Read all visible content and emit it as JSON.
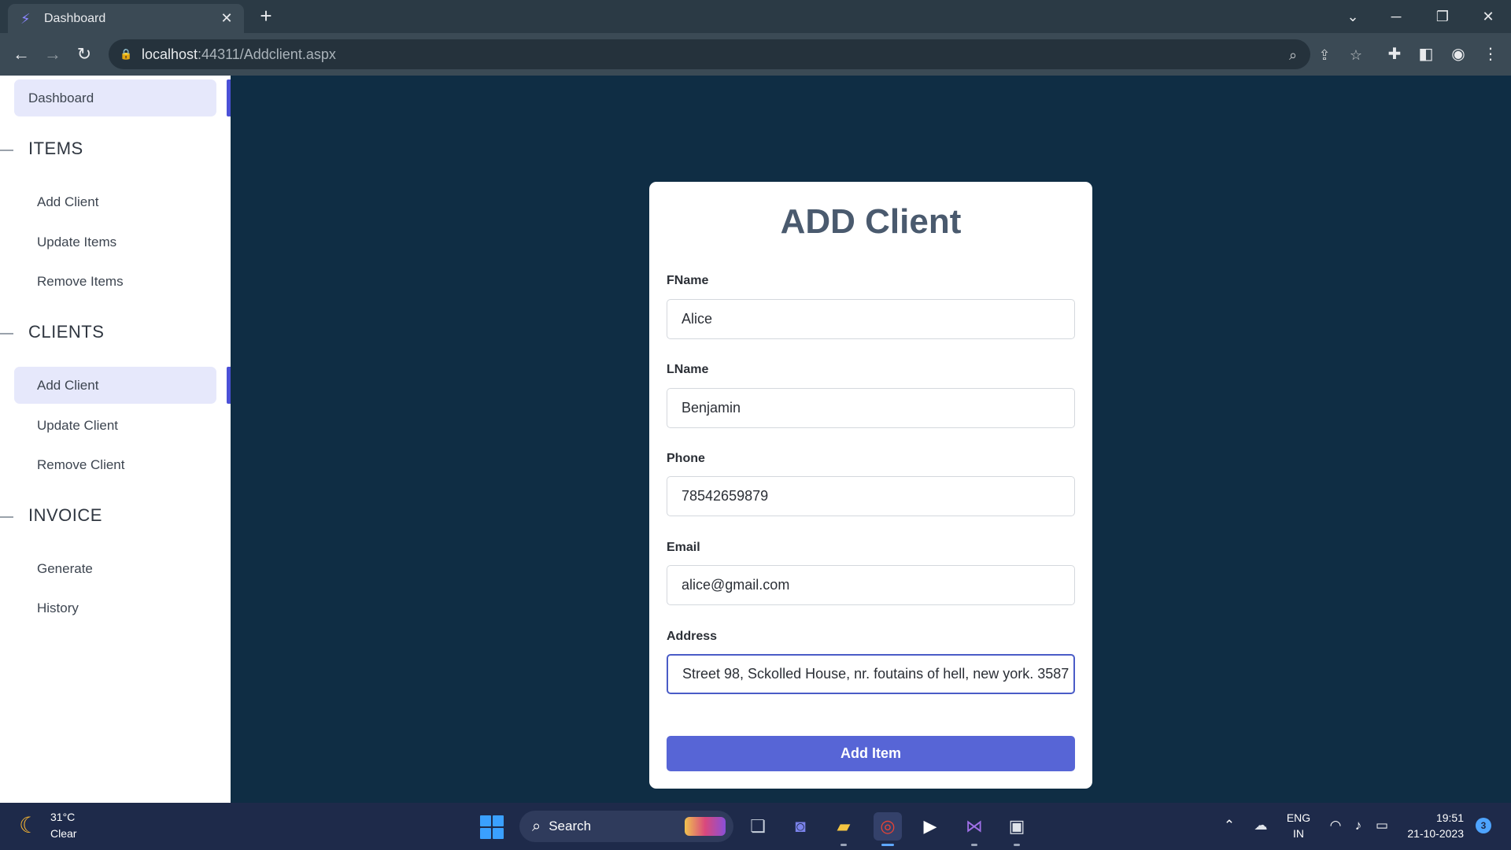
{
  "browser": {
    "tab_title": "Dashboard",
    "tab_close": "✕",
    "new_tab": "+",
    "url_host": "localhost",
    "url_path": ":44311/Addclient.aspx"
  },
  "sidebar": {
    "dashboard": "Dashboard",
    "sections": [
      {
        "title": "ITEMS",
        "items": [
          "Add Client",
          "Update Items",
          "Remove Items"
        ]
      },
      {
        "title": "CLIENTS",
        "items": [
          "Add Client",
          "Update Client",
          "Remove Client"
        ]
      },
      {
        "title": "INVOICE",
        "items": [
          "Generate",
          "History"
        ]
      }
    ],
    "active_item": "CLIENTS > Add Client"
  },
  "form": {
    "title": "ADD Client",
    "fields": [
      {
        "label": "FName",
        "value": "Alice"
      },
      {
        "label": "LName",
        "value": "Benjamin"
      },
      {
        "label": "Phone",
        "value": "78542659879"
      },
      {
        "label": "Email",
        "value": "alice@gmail.com"
      },
      {
        "label": "Address",
        "value": "Street 98, Sckolled House, nr. foutains of hell, new york. 3587"
      }
    ],
    "submit_label": "Add Item"
  },
  "taskbar": {
    "temperature": "31°C",
    "condition": "Clear",
    "search_label": "Search",
    "language": "ENG",
    "region": "IN",
    "time": "19:51",
    "date": "21-10-2023",
    "notifications": "3"
  },
  "colors": {
    "page_background": "#0f2d44",
    "accent": "#5765d6",
    "sidebar_active_bg": "#e6e8fb",
    "active_indicator": "#4b50d6",
    "taskbar": "#1e2a4a"
  }
}
